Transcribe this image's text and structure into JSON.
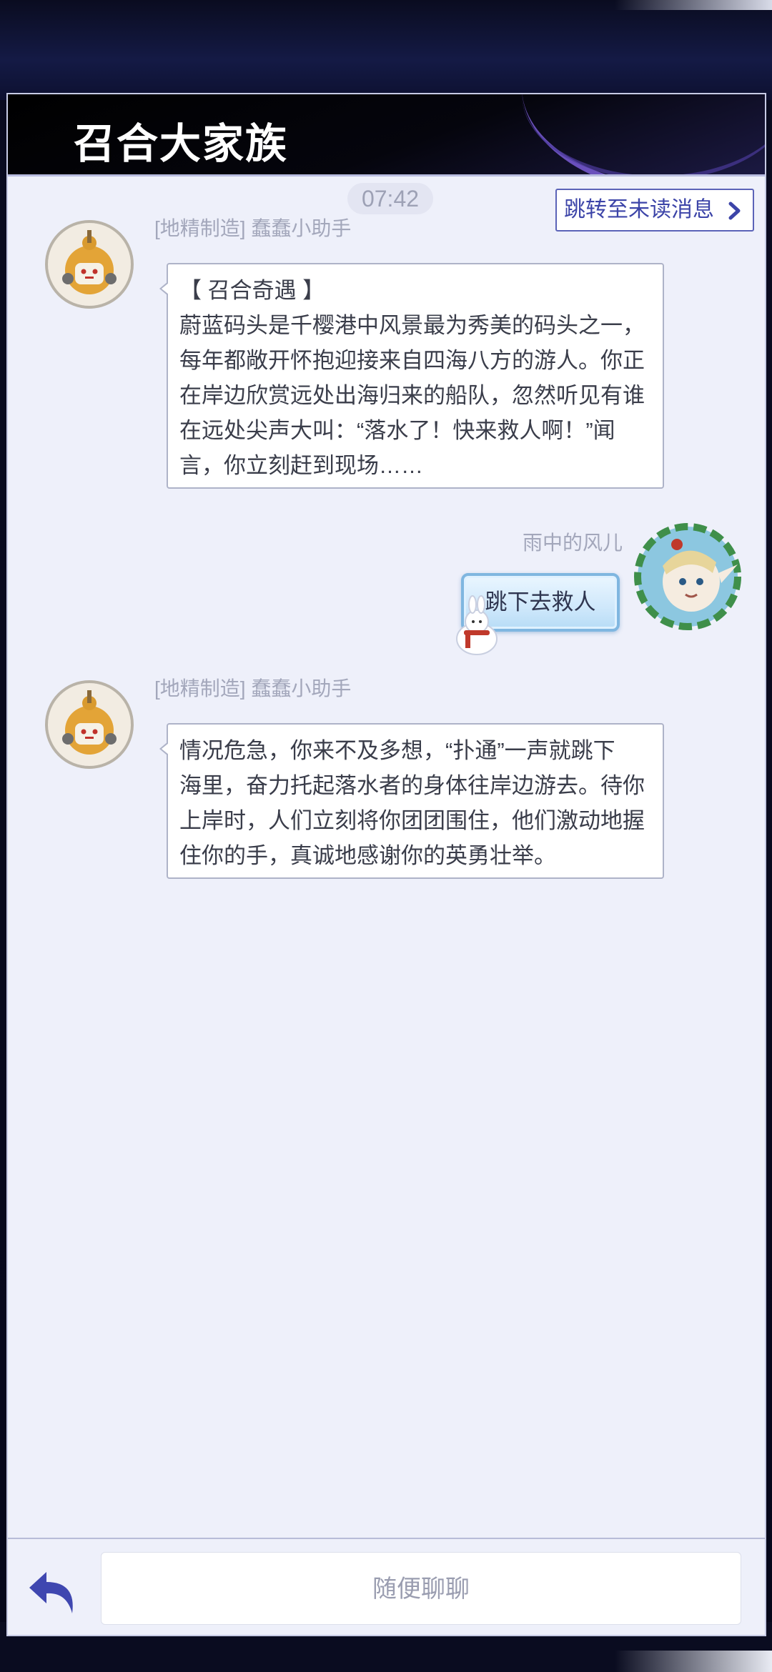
{
  "header": {
    "title": "召合大家族"
  },
  "chat": {
    "time": "07:42",
    "jump_unread_label": "跳转至未读消息",
    "messages": [
      {
        "sender": "[地精制造] 蠢蠢小助手",
        "avatar": "robot-avatar",
        "lines": [
          "【 召合奇遇 】",
          "蔚蓝码头是千樱港中风景最为秀美的码头之一，",
          "每年都敞开怀抱迎接来自四海八方的游人。你正",
          "在岸边欣赏远处出海归来的船队，忽然听见有谁",
          "在远处尖声大叫：“落水了！快来救人啊！”闻",
          "言，你立刻赶到现场……"
        ]
      },
      {
        "sender": "雨中的风儿",
        "avatar": "elf-avatar",
        "text": "跳下去救人"
      },
      {
        "sender": "[地精制造] 蠢蠢小助手",
        "avatar": "robot-avatar",
        "lines": [
          "情况危急，你来不及多想，“扑通”一声就跳下",
          "海里，奋力托起落水者的身体往岸边游去。待你",
          "上岸时，人们立刻将你团团围住，他们激动地握",
          "住你的手，真诚地感谢你的英勇壮举。"
        ]
      }
    ]
  },
  "footer": {
    "input_placeholder": "随便聊聊",
    "back_icon": "back-arrow-icon"
  },
  "colors": {
    "accent": "#3c44a8",
    "panel_bg": "#eef0fa",
    "header_bg": "#000000"
  }
}
